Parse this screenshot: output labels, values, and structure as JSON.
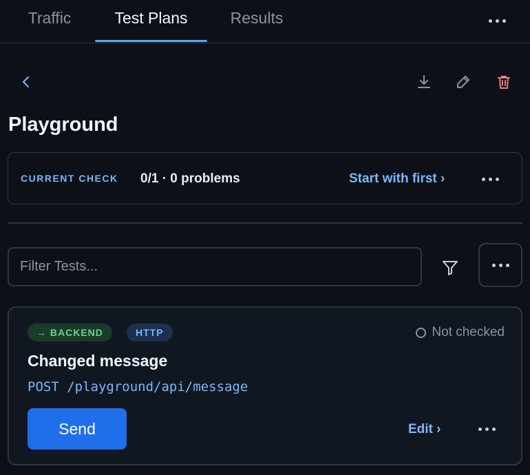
{
  "tabs": [
    {
      "label": "Traffic"
    },
    {
      "label": "Test Plans"
    },
    {
      "label": "Results"
    }
  ],
  "active_tab": "Test Plans",
  "icons": {
    "tabs_more": "more-horizontal-icon",
    "back": "chevron-left-icon",
    "download": "download-icon",
    "edit": "pencil-icon",
    "delete": "trash-icon",
    "filter": "filter-icon",
    "status": "circle-outline-icon"
  },
  "page": {
    "title": "Playground"
  },
  "current_check": {
    "label": "CURRENT CHECK",
    "status": "0/1 · 0 problems",
    "start_link": "Start with first ›"
  },
  "filter": {
    "placeholder": "Filter Tests..."
  },
  "test": {
    "badges": [
      {
        "label": "→ BACKEND",
        "color": "#6ed398",
        "background": "#1b3a2a"
      },
      {
        "label": "HTTP",
        "color": "#79b8ff",
        "background": "#1e3050"
      }
    ],
    "status": "Not checked",
    "title": "Changed message",
    "endpoint": "POST /playground/api/message",
    "send_label": "Send",
    "edit_label": "Edit ›"
  },
  "colors": {
    "background": "#0d1117",
    "accent": "#58a6ff",
    "primary_button": "#1f6feb",
    "delete": "#f47c7c"
  }
}
